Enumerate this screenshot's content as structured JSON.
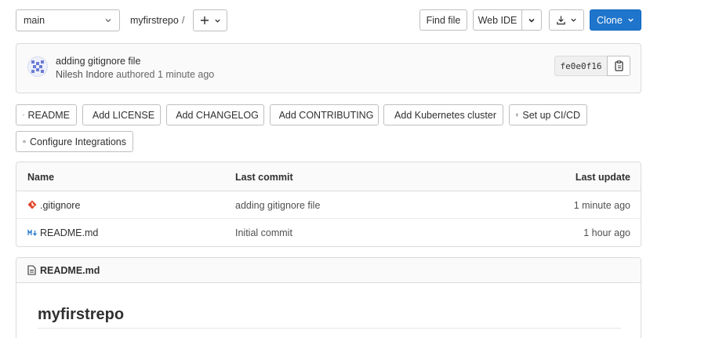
{
  "toolbar": {
    "branch": "main",
    "repo_crumb": "myfirstrepo",
    "crumb_separator": "/",
    "find_file": "Find file",
    "web_ide": "Web IDE",
    "clone": "Clone"
  },
  "commit": {
    "title": "adding gitignore file",
    "author": "Nilesh Indore",
    "authored_text": "authored 1 minute ago",
    "sha": "fe0e0f16"
  },
  "quick_actions": [
    {
      "label": "README",
      "icon": "file-icon"
    },
    {
      "label": "Add LICENSE",
      "icon": "plus-square-icon"
    },
    {
      "label": "Add CHANGELOG",
      "icon": "plus-square-icon"
    },
    {
      "label": "Add CONTRIBUTING",
      "icon": "plus-square-icon"
    },
    {
      "label": "Add Kubernetes cluster",
      "icon": "plus-square-icon"
    },
    {
      "label": "Set up CI/CD",
      "icon": "plus-square-icon"
    },
    {
      "label": "Configure Integrations",
      "icon": "gear-icon"
    }
  ],
  "files": {
    "headers": {
      "name": "Name",
      "last_commit": "Last commit",
      "last_update": "Last update"
    },
    "rows": [
      {
        "name": ".gitignore",
        "icon": "git-icon",
        "commit": "adding gitignore file",
        "updated": "1 minute ago"
      },
      {
        "name": "README.md",
        "icon": "markdown-icon",
        "commit": "Initial commit",
        "updated": "1 hour ago"
      }
    ]
  },
  "readme": {
    "filename": "README.md",
    "heading": "myfirstrepo"
  },
  "colors": {
    "primary": "#1f75cb",
    "git_icon": "#e24329",
    "markdown_icon": "#1f75cb"
  }
}
